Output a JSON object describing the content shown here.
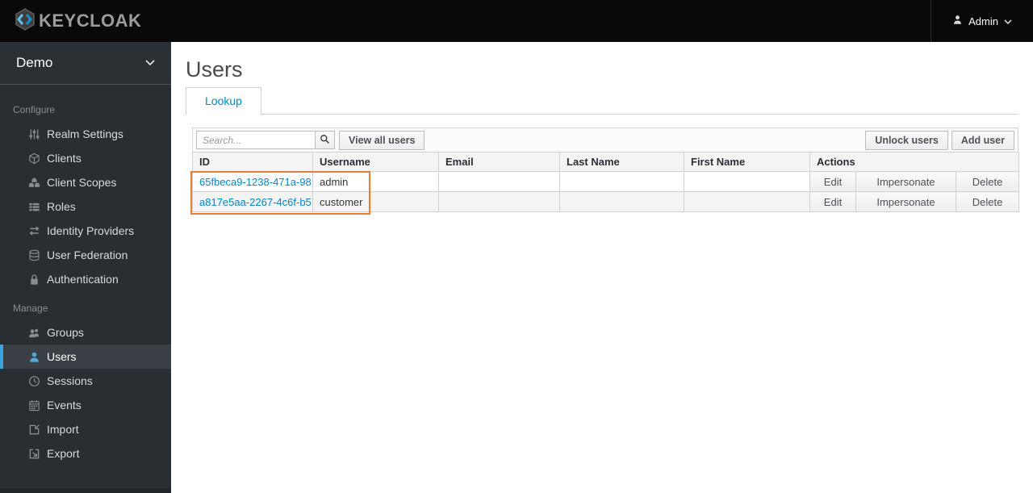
{
  "navbar": {
    "brand": "KEYCLOAK",
    "user_label": "Admin"
  },
  "sidebar": {
    "realm_name": "Demo",
    "sections": [
      {
        "label": "Configure",
        "items": [
          {
            "label": "Realm Settings",
            "icon": "sliders-icon",
            "active": false
          },
          {
            "label": "Clients",
            "icon": "cube-icon",
            "active": false
          },
          {
            "label": "Client Scopes",
            "icon": "cubes-icon",
            "active": false
          },
          {
            "label": "Roles",
            "icon": "list-icon",
            "active": false
          },
          {
            "label": "Identity Providers",
            "icon": "exchange-icon",
            "active": false
          },
          {
            "label": "User Federation",
            "icon": "database-icon",
            "active": false
          },
          {
            "label": "Authentication",
            "icon": "lock-icon",
            "active": false
          }
        ]
      },
      {
        "label": "Manage",
        "items": [
          {
            "label": "Groups",
            "icon": "users-icon",
            "active": false
          },
          {
            "label": "Users",
            "icon": "user-icon",
            "active": true
          },
          {
            "label": "Sessions",
            "icon": "clock-icon",
            "active": false
          },
          {
            "label": "Events",
            "icon": "calendar-icon",
            "active": false
          },
          {
            "label": "Import",
            "icon": "import-icon",
            "active": false
          },
          {
            "label": "Export",
            "icon": "export-icon",
            "active": false
          }
        ]
      }
    ]
  },
  "main": {
    "title": "Users",
    "tabs": [
      {
        "label": "Lookup",
        "active": true
      }
    ],
    "toolbar": {
      "search_placeholder": "Search...",
      "view_all_label": "View all users",
      "unlock_label": "Unlock users",
      "add_label": "Add user"
    },
    "table": {
      "columns": [
        "ID",
        "Username",
        "Email",
        "Last Name",
        "First Name",
        "Actions"
      ],
      "rows": [
        {
          "id": "65fbeca9-1238-471a-98...",
          "username": "admin",
          "email": "",
          "last_name": "",
          "first_name": "",
          "actions": [
            "Edit",
            "Impersonate",
            "Delete"
          ]
        },
        {
          "id": "a817e5aa-2267-4c6f-b5...",
          "username": "customer",
          "email": "",
          "last_name": "",
          "first_name": "",
          "actions": [
            "Edit",
            "Impersonate",
            "Delete"
          ]
        }
      ]
    }
  },
  "colors": {
    "accent_link": "#0088ce",
    "active_nav_border": "#39a5dc",
    "highlight_box": "#ec7c30",
    "sidebar_bg": "#292e33",
    "navbar_bg": "#090909"
  }
}
